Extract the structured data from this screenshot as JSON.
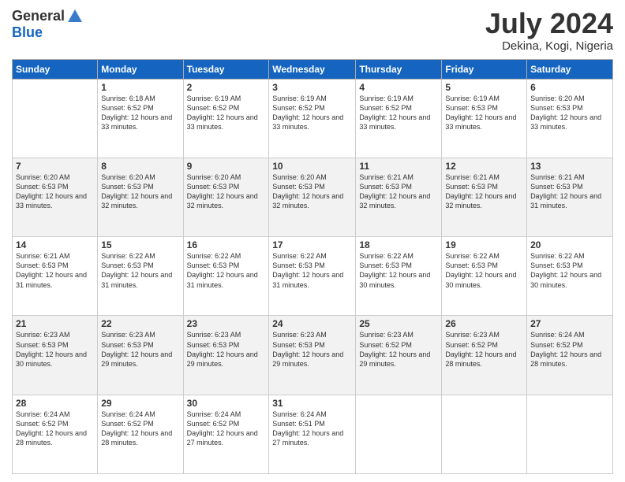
{
  "header": {
    "logo_general": "General",
    "logo_blue": "Blue",
    "month_year": "July 2024",
    "location": "Dekina, Kogi, Nigeria"
  },
  "days_of_week": [
    "Sunday",
    "Monday",
    "Tuesday",
    "Wednesday",
    "Thursday",
    "Friday",
    "Saturday"
  ],
  "weeks": [
    [
      {
        "day": "",
        "sunrise": "",
        "sunset": "",
        "daylight": ""
      },
      {
        "day": "1",
        "sunrise": "Sunrise: 6:18 AM",
        "sunset": "Sunset: 6:52 PM",
        "daylight": "Daylight: 12 hours and 33 minutes."
      },
      {
        "day": "2",
        "sunrise": "Sunrise: 6:19 AM",
        "sunset": "Sunset: 6:52 PM",
        "daylight": "Daylight: 12 hours and 33 minutes."
      },
      {
        "day": "3",
        "sunrise": "Sunrise: 6:19 AM",
        "sunset": "Sunset: 6:52 PM",
        "daylight": "Daylight: 12 hours and 33 minutes."
      },
      {
        "day": "4",
        "sunrise": "Sunrise: 6:19 AM",
        "sunset": "Sunset: 6:52 PM",
        "daylight": "Daylight: 12 hours and 33 minutes."
      },
      {
        "day": "5",
        "sunrise": "Sunrise: 6:19 AM",
        "sunset": "Sunset: 6:53 PM",
        "daylight": "Daylight: 12 hours and 33 minutes."
      },
      {
        "day": "6",
        "sunrise": "Sunrise: 6:20 AM",
        "sunset": "Sunset: 6:53 PM",
        "daylight": "Daylight: 12 hours and 33 minutes."
      }
    ],
    [
      {
        "day": "7",
        "sunrise": "Sunrise: 6:20 AM",
        "sunset": "Sunset: 6:53 PM",
        "daylight": "Daylight: 12 hours and 33 minutes."
      },
      {
        "day": "8",
        "sunrise": "Sunrise: 6:20 AM",
        "sunset": "Sunset: 6:53 PM",
        "daylight": "Daylight: 12 hours and 32 minutes."
      },
      {
        "day": "9",
        "sunrise": "Sunrise: 6:20 AM",
        "sunset": "Sunset: 6:53 PM",
        "daylight": "Daylight: 12 hours and 32 minutes."
      },
      {
        "day": "10",
        "sunrise": "Sunrise: 6:20 AM",
        "sunset": "Sunset: 6:53 PM",
        "daylight": "Daylight: 12 hours and 32 minutes."
      },
      {
        "day": "11",
        "sunrise": "Sunrise: 6:21 AM",
        "sunset": "Sunset: 6:53 PM",
        "daylight": "Daylight: 12 hours and 32 minutes."
      },
      {
        "day": "12",
        "sunrise": "Sunrise: 6:21 AM",
        "sunset": "Sunset: 6:53 PM",
        "daylight": "Daylight: 12 hours and 32 minutes."
      },
      {
        "day": "13",
        "sunrise": "Sunrise: 6:21 AM",
        "sunset": "Sunset: 6:53 PM",
        "daylight": "Daylight: 12 hours and 31 minutes."
      }
    ],
    [
      {
        "day": "14",
        "sunrise": "Sunrise: 6:21 AM",
        "sunset": "Sunset: 6:53 PM",
        "daylight": "Daylight: 12 hours and 31 minutes."
      },
      {
        "day": "15",
        "sunrise": "Sunrise: 6:22 AM",
        "sunset": "Sunset: 6:53 PM",
        "daylight": "Daylight: 12 hours and 31 minutes."
      },
      {
        "day": "16",
        "sunrise": "Sunrise: 6:22 AM",
        "sunset": "Sunset: 6:53 PM",
        "daylight": "Daylight: 12 hours and 31 minutes."
      },
      {
        "day": "17",
        "sunrise": "Sunrise: 6:22 AM",
        "sunset": "Sunset: 6:53 PM",
        "daylight": "Daylight: 12 hours and 31 minutes."
      },
      {
        "day": "18",
        "sunrise": "Sunrise: 6:22 AM",
        "sunset": "Sunset: 6:53 PM",
        "daylight": "Daylight: 12 hours and 30 minutes."
      },
      {
        "day": "19",
        "sunrise": "Sunrise: 6:22 AM",
        "sunset": "Sunset: 6:53 PM",
        "daylight": "Daylight: 12 hours and 30 minutes."
      },
      {
        "day": "20",
        "sunrise": "Sunrise: 6:22 AM",
        "sunset": "Sunset: 6:53 PM",
        "daylight": "Daylight: 12 hours and 30 minutes."
      }
    ],
    [
      {
        "day": "21",
        "sunrise": "Sunrise: 6:23 AM",
        "sunset": "Sunset: 6:53 PM",
        "daylight": "Daylight: 12 hours and 30 minutes."
      },
      {
        "day": "22",
        "sunrise": "Sunrise: 6:23 AM",
        "sunset": "Sunset: 6:53 PM",
        "daylight": "Daylight: 12 hours and 29 minutes."
      },
      {
        "day": "23",
        "sunrise": "Sunrise: 6:23 AM",
        "sunset": "Sunset: 6:53 PM",
        "daylight": "Daylight: 12 hours and 29 minutes."
      },
      {
        "day": "24",
        "sunrise": "Sunrise: 6:23 AM",
        "sunset": "Sunset: 6:53 PM",
        "daylight": "Daylight: 12 hours and 29 minutes."
      },
      {
        "day": "25",
        "sunrise": "Sunrise: 6:23 AM",
        "sunset": "Sunset: 6:52 PM",
        "daylight": "Daylight: 12 hours and 29 minutes."
      },
      {
        "day": "26",
        "sunrise": "Sunrise: 6:23 AM",
        "sunset": "Sunset: 6:52 PM",
        "daylight": "Daylight: 12 hours and 28 minutes."
      },
      {
        "day": "27",
        "sunrise": "Sunrise: 6:24 AM",
        "sunset": "Sunset: 6:52 PM",
        "daylight": "Daylight: 12 hours and 28 minutes."
      }
    ],
    [
      {
        "day": "28",
        "sunrise": "Sunrise: 6:24 AM",
        "sunset": "Sunset: 6:52 PM",
        "daylight": "Daylight: 12 hours and 28 minutes."
      },
      {
        "day": "29",
        "sunrise": "Sunrise: 6:24 AM",
        "sunset": "Sunset: 6:52 PM",
        "daylight": "Daylight: 12 hours and 28 minutes."
      },
      {
        "day": "30",
        "sunrise": "Sunrise: 6:24 AM",
        "sunset": "Sunset: 6:52 PM",
        "daylight": "Daylight: 12 hours and 27 minutes."
      },
      {
        "day": "31",
        "sunrise": "Sunrise: 6:24 AM",
        "sunset": "Sunset: 6:51 PM",
        "daylight": "Daylight: 12 hours and 27 minutes."
      },
      {
        "day": "",
        "sunrise": "",
        "sunset": "",
        "daylight": ""
      },
      {
        "day": "",
        "sunrise": "",
        "sunset": "",
        "daylight": ""
      },
      {
        "day": "",
        "sunrise": "",
        "sunset": "",
        "daylight": ""
      }
    ]
  ]
}
